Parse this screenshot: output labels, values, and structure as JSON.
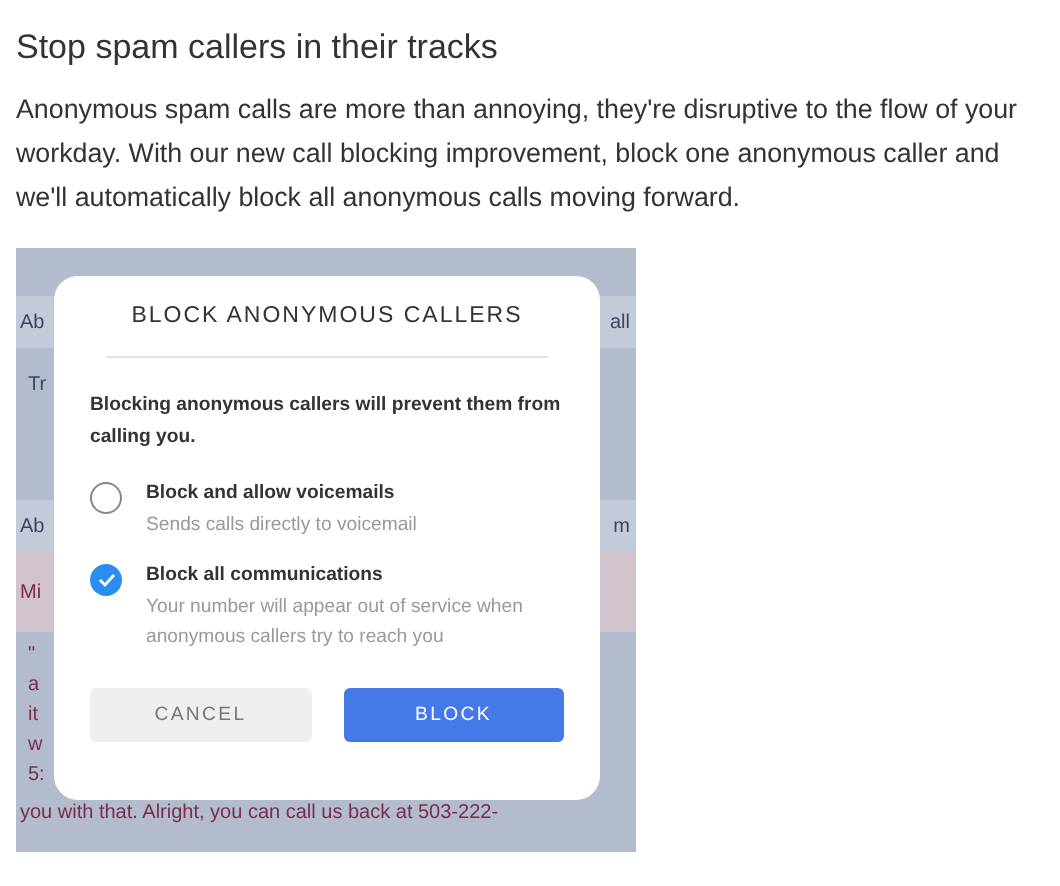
{
  "heading": "Stop spam callers in their tracks",
  "paragraph": "Anonymous spam calls are more than annoying, they're disruptive to the flow of your workday. With our new call blocking improvement, block one anonymous caller and we'll automatically block all anonymous calls moving forward.",
  "background_rows": [
    {
      "kind": "header",
      "left": "Ab",
      "right": "all"
    },
    {
      "kind": "sub",
      "left": "Tr",
      "right": ""
    },
    {
      "kind": "header",
      "left": "Ab",
      "right": "m"
    },
    {
      "kind": "alert",
      "left": "Mi",
      "right": ""
    },
    {
      "kind": "line",
      "left": "\"",
      "right": ""
    },
    {
      "kind": "line",
      "left": "a",
      "right": ""
    },
    {
      "kind": "line",
      "left": "it",
      "right": ""
    },
    {
      "kind": "line",
      "left": "w",
      "right": ""
    },
    {
      "kind": "line",
      "left": "5:",
      "right": ""
    },
    {
      "kind": "full",
      "left": "you with that. Alright, you can call us back at 503-222-",
      "right": ""
    }
  ],
  "dialog": {
    "title": "BLOCK ANONYMOUS CALLERS",
    "message": "Blocking anonymous callers will prevent them from calling you.",
    "options": [
      {
        "label": "Block and allow voicemails",
        "description": "Sends calls directly to voicemail",
        "selected": false
      },
      {
        "label": "Block all communications",
        "description": "Your number will appear out of service when anonymous callers try to reach you",
        "selected": true
      }
    ],
    "buttons": [
      {
        "label": "CANCEL",
        "kind": "secondary"
      },
      {
        "label": "BLOCK",
        "kind": "primary"
      }
    ]
  }
}
